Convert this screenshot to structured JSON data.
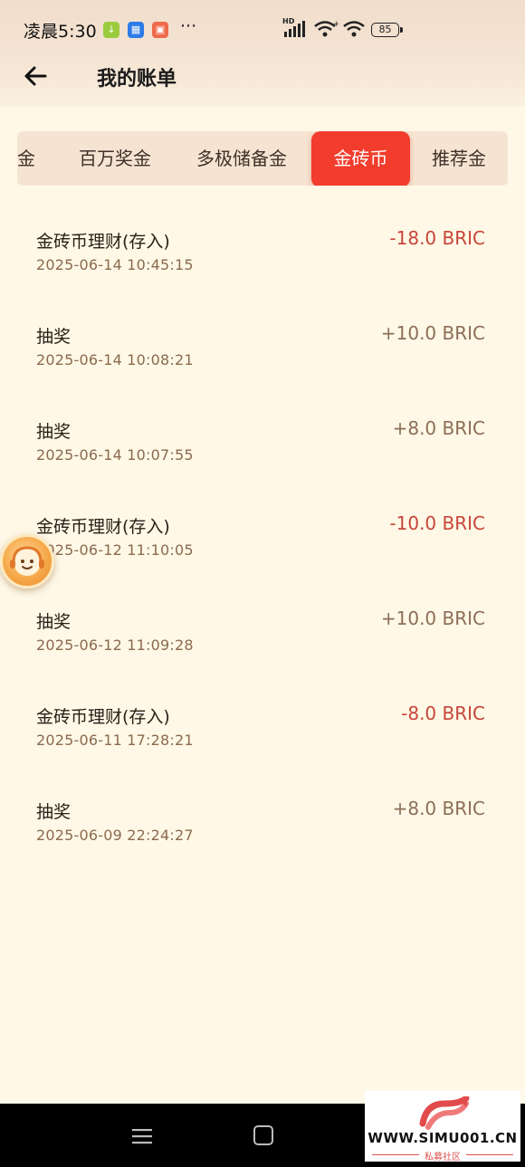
{
  "status_bar": {
    "time": "凌晨5:30",
    "more": "···",
    "signal_label": "HD",
    "battery": "85"
  },
  "header": {
    "title": "我的账单"
  },
  "tabs": [
    {
      "label": "金",
      "active": false
    },
    {
      "label": "百万奖金",
      "active": false
    },
    {
      "label": "多极储备金",
      "active": false
    },
    {
      "label": "金砖币",
      "active": true
    },
    {
      "label": "推荐金",
      "active": false
    }
  ],
  "transactions": [
    {
      "title": "金砖币理财(存入)",
      "time": "2025-06-14 10:45:15",
      "amount": "-18.0 BRIC",
      "sign": "neg"
    },
    {
      "title": "抽奖",
      "time": "2025-06-14 10:08:21",
      "amount": "+10.0 BRIC",
      "sign": "pos"
    },
    {
      "title": "抽奖",
      "time": "2025-06-14 10:07:55",
      "amount": "+8.0 BRIC",
      "sign": "pos"
    },
    {
      "title": "金砖币理财(存入)",
      "time": "2025-06-12 11:10:05",
      "amount": "-10.0 BRIC",
      "sign": "neg"
    },
    {
      "title": "抽奖",
      "time": "2025-06-12 11:09:28",
      "amount": "+10.0 BRIC",
      "sign": "pos"
    },
    {
      "title": "金砖币理财(存入)",
      "time": "2025-06-11 17:28:21",
      "amount": "-8.0 BRIC",
      "sign": "neg"
    },
    {
      "title": "抽奖",
      "time": "2025-06-09 22:24:27",
      "amount": "+8.0 BRIC",
      "sign": "pos"
    }
  ],
  "watermark": {
    "url": "WWW.SIMU001.CN",
    "sub": "私募社区"
  },
  "colors": {
    "accent": "#f23c2c",
    "negative": "#c7453a",
    "background": "#fff8e6"
  },
  "icons": {
    "back": "arrow-left-icon",
    "service": "customer-service-icon",
    "menu": "menu-lines-icon",
    "home": "home-square-icon"
  }
}
